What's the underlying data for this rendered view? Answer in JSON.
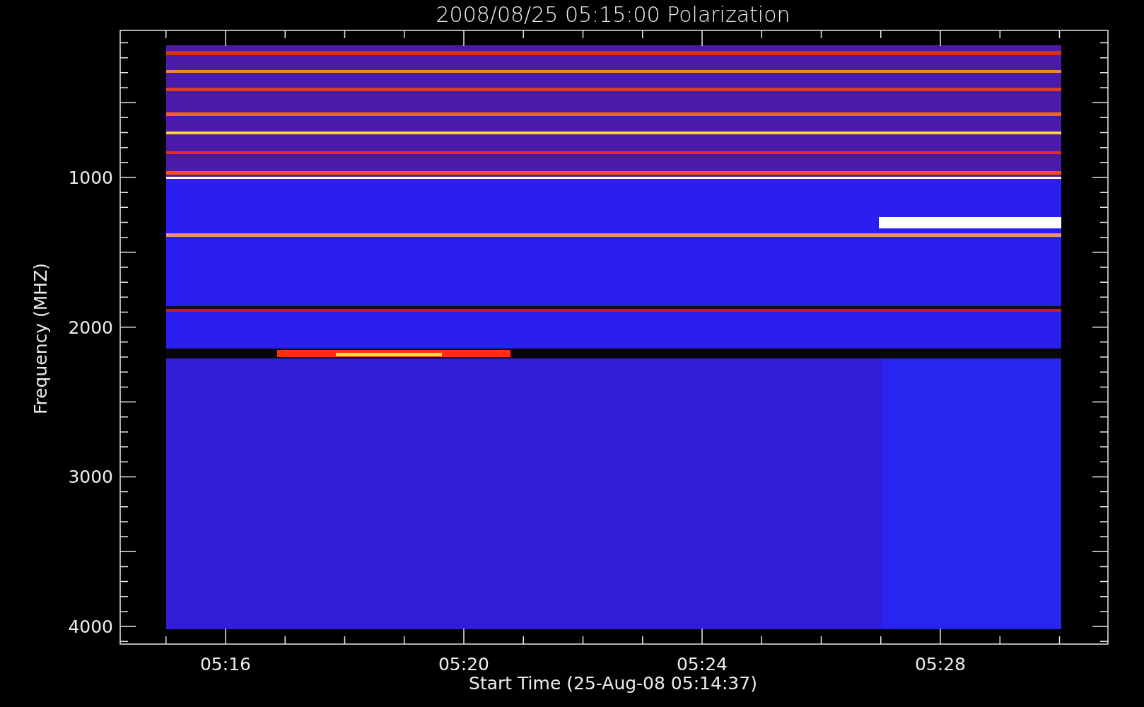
{
  "title": "2008/08/25 05:15:00 Polarization",
  "y_axis": {
    "label": "Frequency (MHZ)",
    "ticks": [
      "1000",
      "2000",
      "3000",
      "4000"
    ]
  },
  "x_axis": {
    "label": "Start Time (25-Aug-08 05:14:37)",
    "ticks": [
      "05:16",
      "05:20",
      "05:24",
      "05:28"
    ]
  }
}
